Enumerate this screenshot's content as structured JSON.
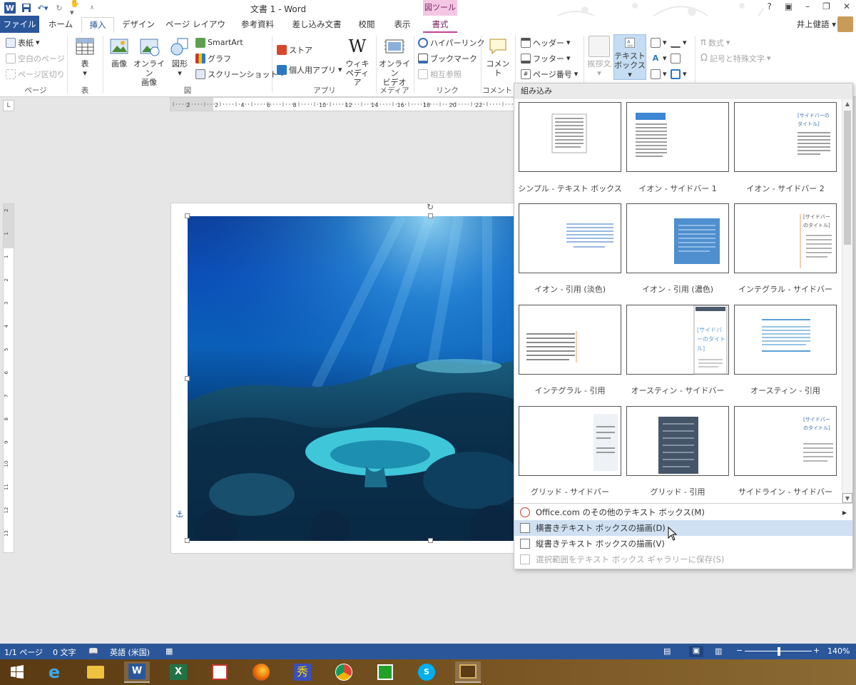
{
  "window": {
    "title": "文書 1 - Word",
    "context_tab_group": "図ツール",
    "context_tab": "書式",
    "controls": [
      "?",
      "▣",
      "–",
      "❐",
      "✕"
    ],
    "user_name": "井上健語"
  },
  "tabs": [
    "ファイル",
    "ホーム",
    "挿入",
    "デザイン",
    "ページ レイアウト",
    "参考資料",
    "差し込み文書",
    "校閲",
    "表示"
  ],
  "active_tab": "挿入",
  "ribbon": {
    "pages": {
      "cover": "表紙",
      "blank": "空白のページ",
      "break": "ページ区切り",
      "label": "ページ"
    },
    "table": {
      "button": "表",
      "label": "表"
    },
    "illustrations": {
      "picture": "画像",
      "online1": "オンライン",
      "online2": "画像",
      "shapes": "図形",
      "smartart": "SmartArt",
      "chart": "グラフ",
      "screenshot": "スクリーンショット",
      "label": "図"
    },
    "apps": {
      "store": "ストア",
      "myapps": "個人用アプリ",
      "wiki1": "ウィキ",
      "wiki2": "ペディア",
      "label": "アプリ"
    },
    "media": {
      "video1": "オンライン",
      "video2": "ビデオ",
      "label": "メディア"
    },
    "links": {
      "hyperlink": "ハイパーリンク",
      "bookmark": "ブックマーク",
      "crossref": "相互参照",
      "label": "リンク"
    },
    "comments": {
      "comment": "コメント",
      "label": "コメント"
    },
    "header_footer": {
      "header": "ヘッダー",
      "footer": "フッター",
      "page_number": "ページ番号"
    },
    "text": {
      "greeting": "挨拶文",
      "textbox1": "テキスト",
      "textbox2": "ボックス"
    },
    "symbols": {
      "equation": "数式",
      "symbol": "記号と特殊文字"
    }
  },
  "ruler_numbers": [
    "2",
    "2",
    "4",
    "6",
    "8",
    "10",
    "12",
    "14",
    "16",
    "18",
    "20",
    "22"
  ],
  "vruler_numbers": [
    "2",
    "1",
    "1",
    "2",
    "3",
    "4",
    "5",
    "6",
    "7",
    "8",
    "9",
    "10",
    "11",
    "12",
    "13"
  ],
  "dropdown": {
    "header": "組み込み",
    "labels": [
      "シンプル - テキスト ボックス",
      "イオン - サイドバー 1",
      "イオン - サイドバー 2",
      "イオン - 引用 (淡色)",
      "イオン - 引用 (濃色)",
      "インテグラル - サイドバー",
      "インテグラル - 引用",
      "オースティン - サイドバー",
      "オースティン - 引用",
      "グリッド - サイドバー",
      "グリッド - 引用",
      "サイドライン - サイドバー"
    ],
    "thumb_texts": {
      "sidebar_title": "[サイドバーのタイトル]",
      "sidebar_title_2": "[サイドバーのタイトル]",
      "sidebar_title_3": "[サイドバーのタイトル]",
      "sidebar_title_4": "[サイドバーのタイトル]"
    },
    "menu": [
      {
        "label": "Office.com のその他のテキスト ボックス(M)",
        "has_arrow": true
      },
      {
        "label": "横書きテキスト ボックスの描画(D)",
        "hover": true
      },
      {
        "label": "縦書きテキスト ボックスの描画(V)"
      },
      {
        "label": "選択範囲をテキスト ボックス ギャラリーに保存(S)",
        "disabled": true
      }
    ]
  },
  "status": {
    "page": "1/1 ページ",
    "words": "0 文字",
    "language": "英語 (米国)",
    "zoom": "140%"
  },
  "colors": {
    "word_blue": "#2b579a",
    "context_pink": "#f3c7e4",
    "hover_blue": "#cfe0f2"
  },
  "taskbar_icons": [
    "windows-start-icon",
    "ie-icon",
    "explorer-icon",
    "word-icon",
    "excel-icon",
    "app-icon",
    "firefox-icon",
    "app2-icon",
    "chrome-icon",
    "store-icon",
    "skype-icon",
    "app3-icon"
  ]
}
